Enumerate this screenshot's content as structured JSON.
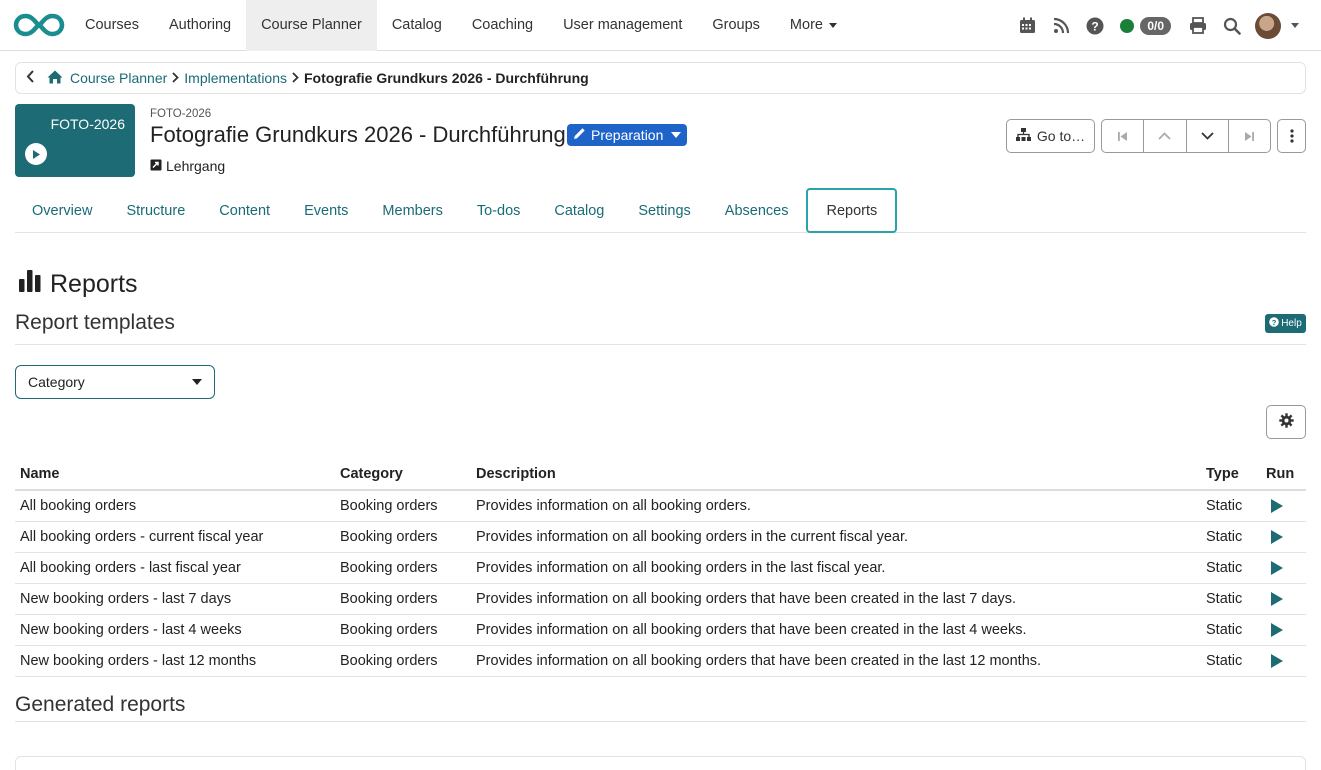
{
  "nav": {
    "items": [
      "Courses",
      "Authoring",
      "Course Planner",
      "Catalog",
      "Coaching",
      "User management",
      "Groups",
      "More"
    ],
    "active_index": 2,
    "badge": "0/0",
    "online_status_color": "#1a7f37"
  },
  "breadcrumb": {
    "items": [
      "Course Planner",
      "Implementations"
    ],
    "current": "Fotografie Grundkurs 2026 - Durchführung"
  },
  "header": {
    "tile_label": "FOTO-2026",
    "ext_ref": "FOTO-2026",
    "title": "Fotografie Grundkurs 2026 - Durchführung",
    "status": "Preparation",
    "type": "Lehrgang",
    "goto_label": "Go to…"
  },
  "tabs": [
    "Overview",
    "Structure",
    "Content",
    "Events",
    "Members",
    "To-dos",
    "Catalog",
    "Settings",
    "Absences",
    "Reports"
  ],
  "active_tab": 9,
  "reports": {
    "heading": "Reports",
    "templates_title": "Report templates",
    "help_label": "Help",
    "category_select": "Category",
    "columns": [
      "Name",
      "Category",
      "Description",
      "Type",
      "Run"
    ],
    "rows": [
      {
        "name": "All booking orders",
        "category": "Booking orders",
        "description": "Provides information on all booking orders.",
        "type": "Static"
      },
      {
        "name": "All booking orders - current fiscal year",
        "category": "Booking orders",
        "description": "Provides information on all booking orders in the current fiscal year.",
        "type": "Static"
      },
      {
        "name": "All booking orders - last fiscal year",
        "category": "Booking orders",
        "description": "Provides information on all booking orders in the last fiscal year.",
        "type": "Static"
      },
      {
        "name": "New booking orders - last 7 days",
        "category": "Booking orders",
        "description": "Provides information on all booking orders that have been created in the last 7 days.",
        "type": "Static"
      },
      {
        "name": "New booking orders - last 4 weeks",
        "category": "Booking orders",
        "description": "Provides information on all booking orders that have been created in the last 4 weeks.",
        "type": "Static"
      },
      {
        "name": "New booking orders - last 12 months",
        "category": "Booking orders",
        "description": "Provides information on all booking orders that have been created in the last 12 months.",
        "type": "Static"
      }
    ],
    "generated_title": "Generated reports"
  },
  "colors": {
    "primary": "#1c6b75",
    "status_blue": "#1e63c8",
    "active_tab_border": "#2aa4a8"
  }
}
